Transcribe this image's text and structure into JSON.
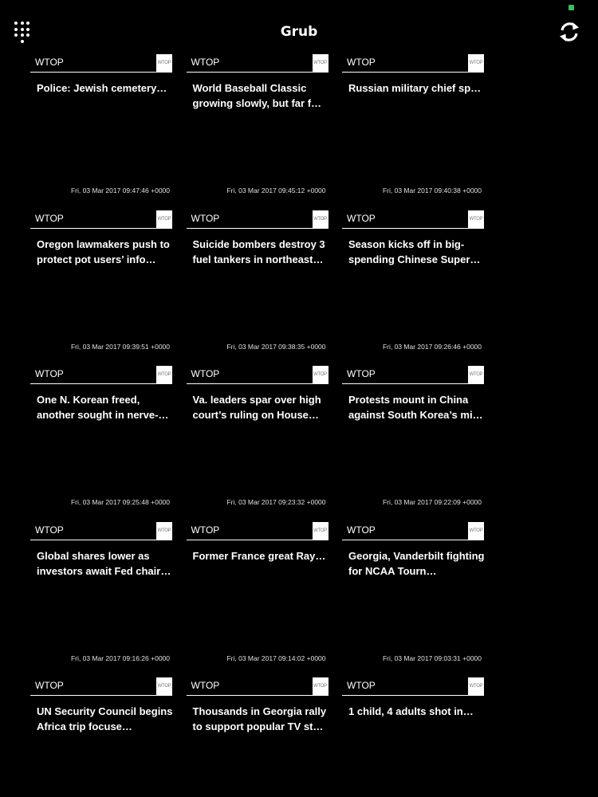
{
  "app": {
    "title": "Grub",
    "menu_icon": "grid-dots-icon",
    "refresh_icon": "refresh-icon",
    "status_color": "#3dbb5c"
  },
  "cards": [
    {
      "source": "WTOP",
      "logo": "WTOP",
      "headline": "Police: Jewish cemetery…",
      "timestamp": "Fri, 03 Mar 2017 09:47:46 +0000"
    },
    {
      "source": "WTOP",
      "logo": "WTOP",
      "headline": "World Baseball Classic growing slowly, but far f…",
      "timestamp": "Fri, 03 Mar 2017 09:45:12 +0000"
    },
    {
      "source": "WTOP",
      "logo": "WTOP",
      "headline": "Russian military chief sp…",
      "timestamp": "Fri, 03 Mar 2017 09:40:38 +0000"
    },
    {
      "source": "WTOP",
      "logo": "WTOP",
      "headline": "Oregon lawmakers push to protect pot users’ info…",
      "timestamp": "Fri, 03 Mar 2017 09:39:51 +0000"
    },
    {
      "source": "WTOP",
      "logo": "WTOP",
      "headline": "Suicide bombers destroy 3 fuel tankers in northeast…",
      "timestamp": "Fri, 03 Mar 2017 09:38:35 +0000"
    },
    {
      "source": "WTOP",
      "logo": "WTOP",
      "headline": "Season kicks off in big-spending Chinese Super…",
      "timestamp": "Fri, 03 Mar 2017 09:26:46 +0000"
    },
    {
      "source": "WTOP",
      "logo": "WTOP",
      "headline": "One N. Korean freed, another sought in nerve-…",
      "timestamp": "Fri, 03 Mar 2017 09:25:48 +0000"
    },
    {
      "source": "WTOP",
      "logo": "WTOP",
      "headline": "Va. leaders spar over high court’s ruling on House…",
      "timestamp": "Fri, 03 Mar 2017 09:23:32 +0000"
    },
    {
      "source": "WTOP",
      "logo": "WTOP",
      "headline": "Protests mount in China against South Korea’s mi…",
      "timestamp": "Fri, 03 Mar 2017 09:22:09 +0000"
    },
    {
      "source": "WTOP",
      "logo": "WTOP",
      "headline": "Global shares lower as investors await Fed chair…",
      "timestamp": "Fri, 03 Mar 2017 09:16:26 +0000"
    },
    {
      "source": "WTOP",
      "logo": "WTOP",
      "headline": "Former France great Ray…",
      "timestamp": "Fri, 03 Mar 2017 09:14:02 +0000"
    },
    {
      "source": "WTOP",
      "logo": "WTOP",
      "headline": "Georgia, Vanderbilt fighting for NCAA Tourn…",
      "timestamp": "Fri, 03 Mar 2017 09:03:31 +0000"
    },
    {
      "source": "WTOP",
      "logo": "WTOP",
      "headline": "UN Security Council begins Africa trip focuse…",
      "timestamp": ""
    },
    {
      "source": "WTOP",
      "logo": "WTOP",
      "headline": "Thousands in Georgia rally to support popular TV st…",
      "timestamp": ""
    },
    {
      "source": "WTOP",
      "logo": "WTOP",
      "headline": "1 child, 4 adults shot in…",
      "timestamp": ""
    }
  ]
}
